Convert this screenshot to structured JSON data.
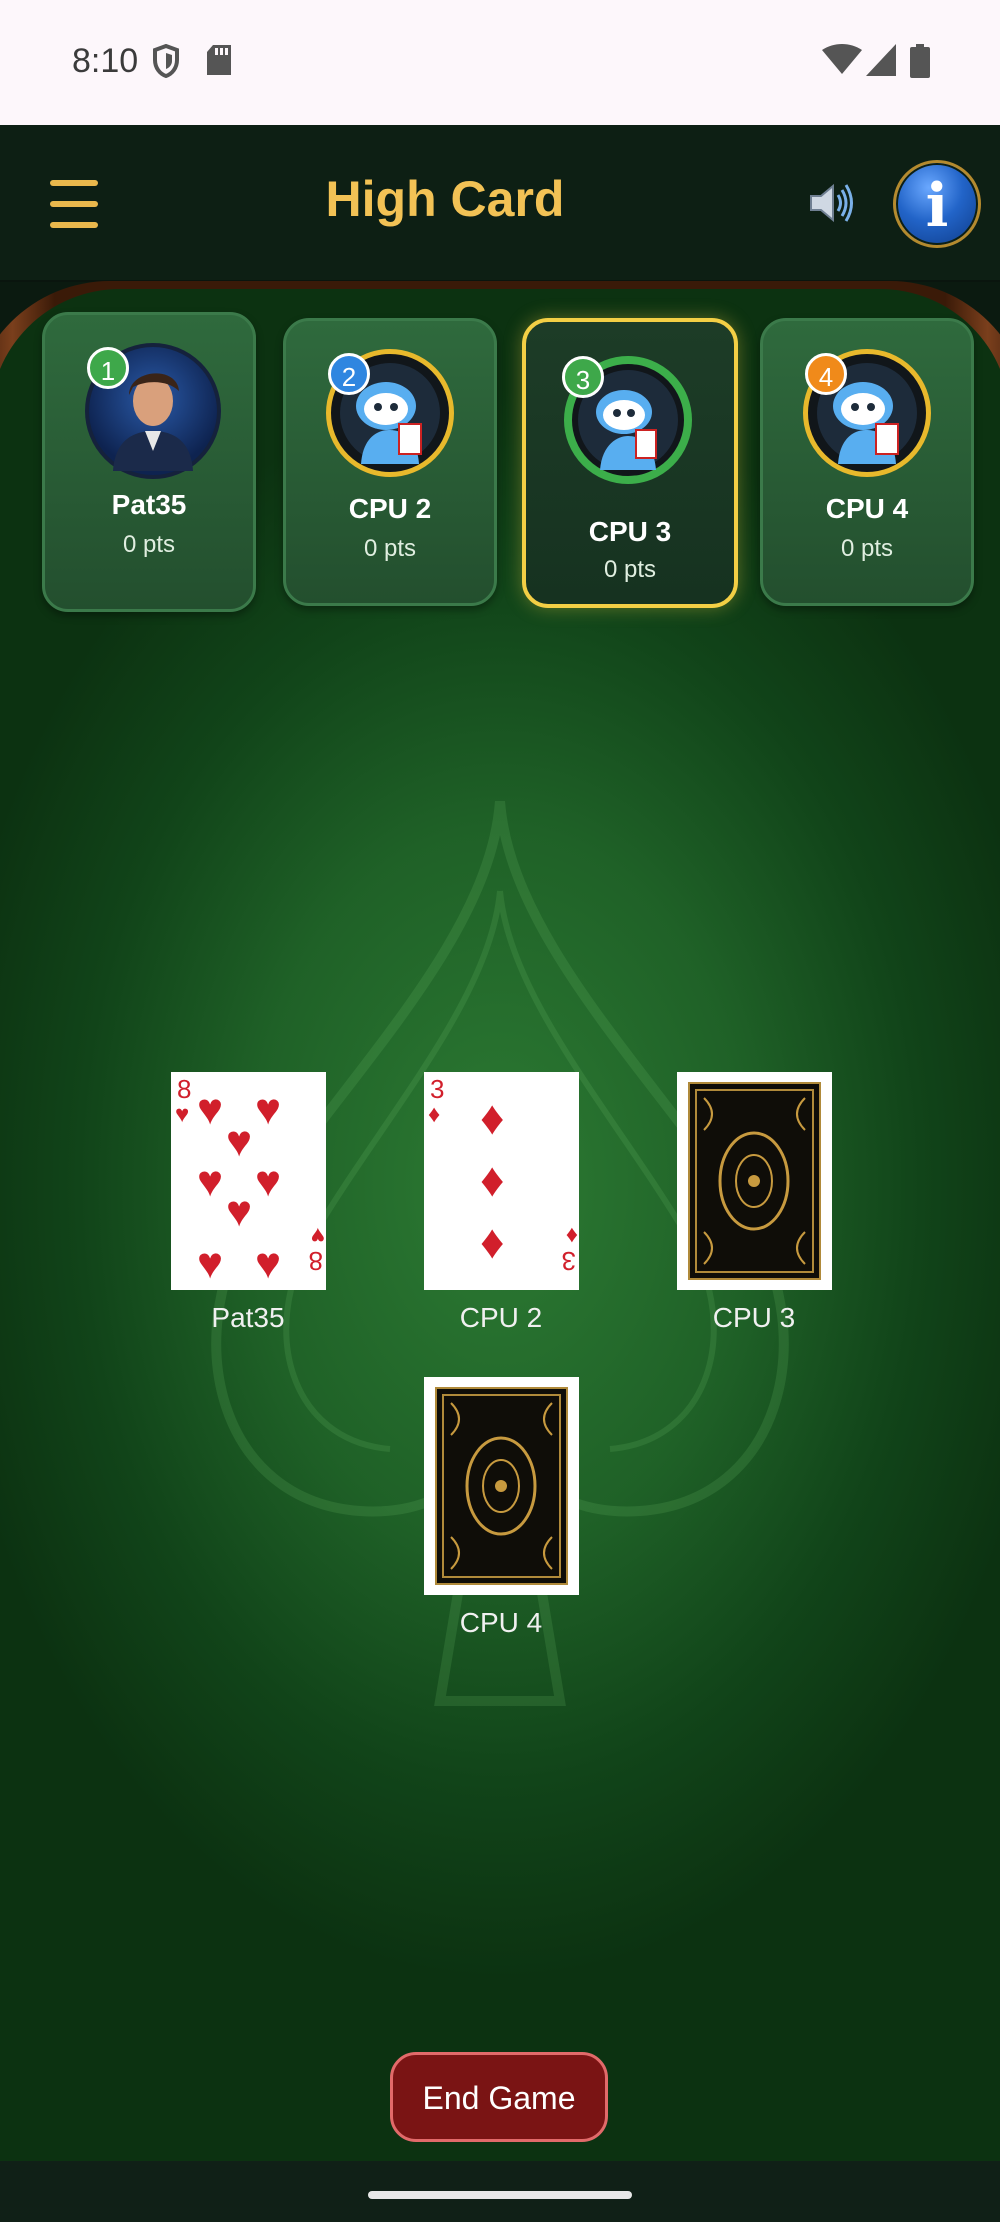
{
  "status_bar": {
    "time": "8:10"
  },
  "header": {
    "title": "High Card"
  },
  "players": [
    {
      "badge": "1",
      "name": "Pat35",
      "points": "0 pts",
      "badge_color": "#3ea84a",
      "active": false
    },
    {
      "badge": "2",
      "name": "CPU 2",
      "points": "0 pts",
      "badge_color": "#2f86e0",
      "active": false
    },
    {
      "badge": "3",
      "name": "CPU 3",
      "points": "0 pts",
      "badge_color": "#3ea84a",
      "active": true
    },
    {
      "badge": "4",
      "name": "CPU 4",
      "points": "0 pts",
      "badge_color": "#f08a1a",
      "active": false
    }
  ],
  "played_cards": [
    {
      "player": "Pat35",
      "card": {
        "rank": "8",
        "suit": "hearts",
        "face_up": true
      }
    },
    {
      "player": "CPU 2",
      "card": {
        "rank": "3",
        "suit": "diamonds",
        "face_up": true
      }
    },
    {
      "player": "CPU 3",
      "card": {
        "face_up": false
      }
    },
    {
      "player": "CPU 4",
      "card": {
        "face_up": false
      }
    }
  ],
  "actions": {
    "end_game": "End Game"
  },
  "icons": [
    "menu-icon",
    "sound-icon",
    "info-icon",
    "shield-icon",
    "sd-card-icon",
    "wifi-icon",
    "signal-icon",
    "battery-icon"
  ],
  "colors": {
    "accent_gold": "#f2c255",
    "felt_green": "#1f6127",
    "active_border": "#f3cf45",
    "end_button": "#7a1414"
  }
}
